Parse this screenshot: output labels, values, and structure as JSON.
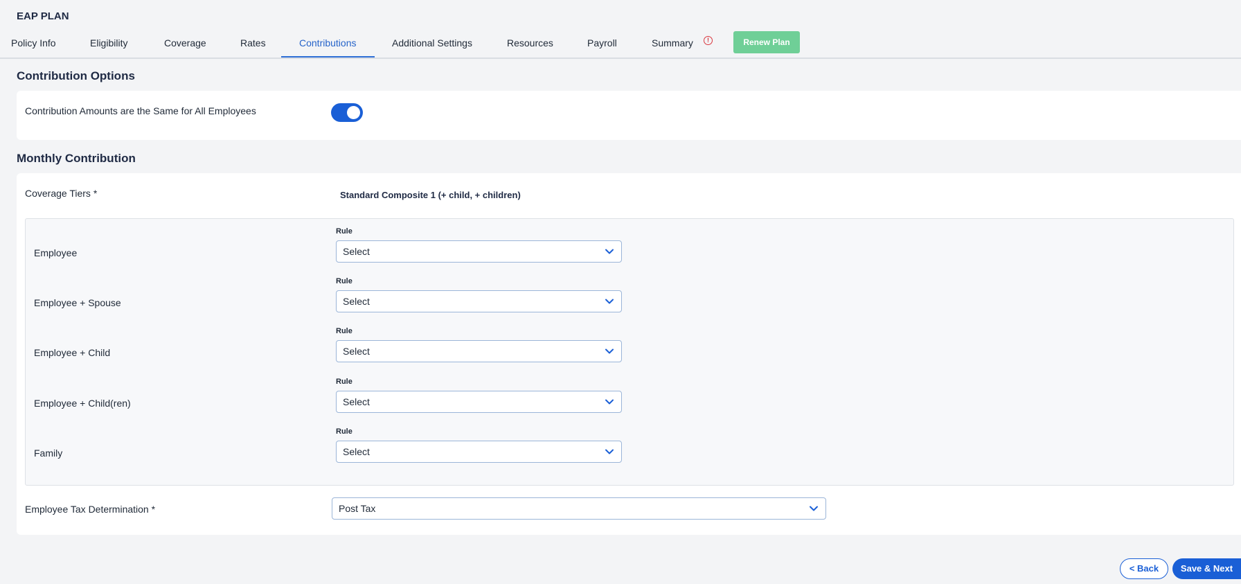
{
  "page": {
    "title": "EAP PLAN"
  },
  "tabs": [
    {
      "label": "Policy Info"
    },
    {
      "label": "Eligibility"
    },
    {
      "label": "Coverage"
    },
    {
      "label": "Rates"
    },
    {
      "label": "Contributions",
      "active": true
    },
    {
      "label": "Additional Settings"
    },
    {
      "label": "Resources"
    },
    {
      "label": "Payroll"
    },
    {
      "label": "Summary",
      "icon": "alert-circle-icon"
    }
  ],
  "renew_button": {
    "label": "Renew Plan",
    "color": "#6fcf97"
  },
  "contribution_options": {
    "heading": "Contribution Options",
    "same_amounts_label": "Contribution Amounts are the Same for All Employees",
    "same_amounts_toggle": true
  },
  "monthly_contribution": {
    "heading": "Monthly Contribution",
    "coverage_tiers_label": "Coverage Tiers *",
    "coverage_tiers_value": "Standard Composite 1 (+ child, + children)",
    "tiers": [
      {
        "name": "Employee",
        "rule_label": "Rule",
        "rule_value": "Select"
      },
      {
        "name": "Employee + Spouse",
        "rule_label": "Rule",
        "rule_value": "Select"
      },
      {
        "name": "Employee + Child",
        "rule_label": "Rule",
        "rule_value": "Select"
      },
      {
        "name": "Employee + Child(ren)",
        "rule_label": "Rule",
        "rule_value": "Select"
      },
      {
        "name": "Family",
        "rule_label": "Rule",
        "rule_value": "Select"
      }
    ],
    "tax_label": "Employee Tax Determination *",
    "tax_value": "Post Tax"
  },
  "footer": {
    "back_label": "< Back",
    "next_label": "Save & Next"
  },
  "colors": {
    "primary": "#1a5fd6",
    "active_tab": "#2563c9",
    "alert": "#d9363e"
  }
}
